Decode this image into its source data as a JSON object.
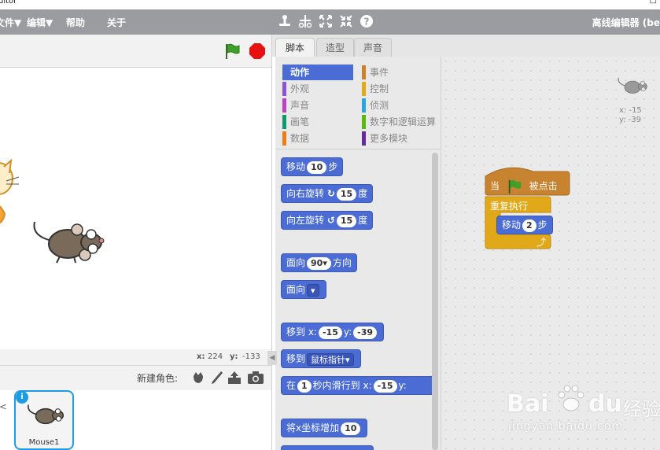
{
  "window": {
    "title": "ditor",
    "close_glyph": "□"
  },
  "menubar": {
    "items": [
      "文件▼",
      "编辑▼",
      "帮助",
      "关于"
    ],
    "tools": [
      "stamp-icon",
      "cut-icon",
      "grow-icon",
      "shrink-icon",
      "help-icon"
    ],
    "right_label": "离线编辑器 (be"
  },
  "stage": {
    "mouse_x_label": "x:",
    "mouse_x": "224",
    "mouse_y_label": "y:",
    "mouse_y": "-133"
  },
  "sprites": {
    "new_sprite_label": "新建角色:",
    "items": [
      {
        "name": "Mouse1",
        "info": "i"
      }
    ],
    "arrow": "<"
  },
  "tabs": [
    "脚本",
    "造型",
    "声音"
  ],
  "categories": {
    "left": [
      {
        "label": "动作",
        "color": "#4a6cd4"
      },
      {
        "label": "外观",
        "color": "#8a55d7"
      },
      {
        "label": "声音",
        "color": "#bb42c3"
      },
      {
        "label": "画笔",
        "color": "#0e9a6c"
      },
      {
        "label": "数据",
        "color": "#ee7d16"
      }
    ],
    "right": [
      {
        "label": "事件",
        "color": "#c88330"
      },
      {
        "label": "控制",
        "color": "#e1a91a"
      },
      {
        "label": "侦测",
        "color": "#2ca5e2"
      },
      {
        "label": "数字和逻辑运算",
        "color": "#5cb712"
      },
      {
        "label": "更多模块",
        "color": "#632d99"
      }
    ]
  },
  "blocks": {
    "move": {
      "a": "移动",
      "v": "10",
      "b": "步"
    },
    "turn_right": {
      "a": "向右旋转",
      "icon": "↻",
      "v": "15",
      "b": "度"
    },
    "turn_left": {
      "a": "向左旋转",
      "icon": "↺",
      "v": "15",
      "b": "度"
    },
    "point_dir": {
      "a": "面向",
      "v": "90▾",
      "b": "方向"
    },
    "point_towards": {
      "a": "面向",
      "v": "▾"
    },
    "goto_xy": {
      "a": "移到 x:",
      "x": "-15",
      "m": "y:",
      "y": "-39"
    },
    "goto": {
      "a": "移到",
      "v": "鼠标指针▾"
    },
    "glide": {
      "a": "在",
      "v": "1",
      "m": "秒内滑行到 x:",
      "x": "-15",
      "b": "y:"
    },
    "change_x": {
      "a": "将x坐标增加",
      "v": "10"
    }
  },
  "script": {
    "sprite_x": "x: -15",
    "sprite_y": "y: -39",
    "hat": {
      "a": "当",
      "b": "被点击"
    },
    "forever": "重复执行",
    "move": {
      "a": "移动",
      "v": "2",
      "b": "步"
    },
    "loop_arrow": "⤴"
  },
  "watermark": {
    "brand": "Bai",
    "brand2": "du",
    "suffix": "经验",
    "url": "jingyan.baidu.com"
  },
  "colors": {
    "motion": "#4a6cd4",
    "events": "#c88330",
    "control": "#e1a91a",
    "menubar": "#9a9c9f"
  }
}
